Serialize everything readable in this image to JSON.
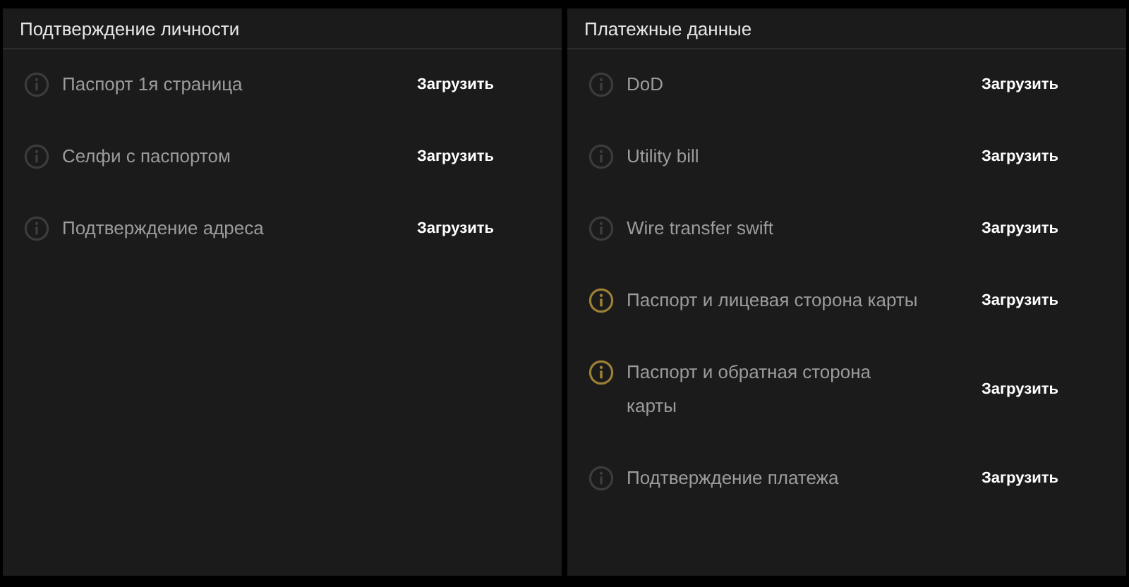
{
  "panels": [
    {
      "title": "Подтверждение личности",
      "items": [
        {
          "label": "Паспорт 1я страница",
          "action": "Загрузить",
          "color": "#3c3c3c"
        },
        {
          "label": "Селфи с паспортом",
          "action": "Загрузить",
          "color": "#3c3c3c"
        },
        {
          "label": "Подтверждение адреса",
          "action": "Загрузить",
          "color": "#3c3c3c"
        }
      ]
    },
    {
      "title": "Платежные данные",
      "items": [
        {
          "label": "DoD",
          "action": "Загрузить",
          "color": "#3c3c3c"
        },
        {
          "label": "Utility bill",
          "action": "Загрузить",
          "color": "#3c3c3c"
        },
        {
          "label": "Wire transfer swift",
          "action": "Загрузить",
          "color": "#3c3c3c"
        },
        {
          "label": "Паспорт и лицевая сторона карты",
          "action": "Загрузить",
          "color": "#9b8035"
        },
        {
          "label": "Паспорт и обратная сторона карты",
          "action": "Загрузить",
          "color": "#9b8035"
        },
        {
          "label": "Подтверждение платежа",
          "action": "Загрузить",
          "color": "#3c3c3c"
        }
      ]
    }
  ]
}
